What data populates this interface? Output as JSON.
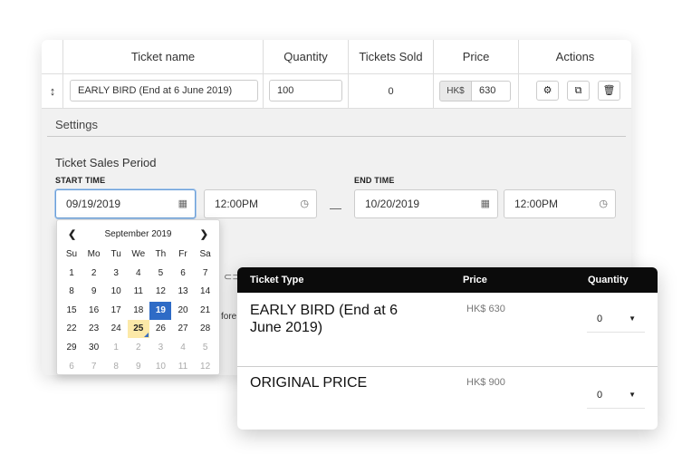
{
  "table": {
    "headers": [
      "Ticket name",
      "Quantity",
      "Tickets Sold",
      "Price",
      "Actions"
    ],
    "row": {
      "drag_icon": "drag-handle-icon",
      "ticket_name": "EARLY BIRD (End at 6 June 2019)",
      "quantity": "100",
      "tickets_sold": "0",
      "currency": "HK$",
      "price": "630",
      "actions": [
        "gear-icon",
        "copy-icon",
        "trash-icon"
      ]
    }
  },
  "settings": {
    "title": "Settings",
    "period_title": "Ticket Sales Period",
    "start_label": "START TIME",
    "end_label": "END TIME",
    "start_date": "09/19/2019",
    "start_time": "12:00PM",
    "end_date": "10/20/2019",
    "end_time": "12:00PM",
    "separator": "—",
    "partial_text": "fore"
  },
  "datepicker": {
    "month_label": "September 2019",
    "weekdays": [
      "Su",
      "Mo",
      "Tu",
      "We",
      "Th",
      "Fr",
      "Sa"
    ],
    "weeks": [
      [
        "1",
        "2",
        "3",
        "4",
        "5",
        "6",
        "7"
      ],
      [
        "8",
        "9",
        "10",
        "11",
        "12",
        "13",
        "14"
      ],
      [
        "15",
        "16",
        "17",
        "18",
        "19",
        "20",
        "21"
      ],
      [
        "22",
        "23",
        "24",
        "25",
        "26",
        "27",
        "28"
      ],
      [
        "29",
        "30",
        "1",
        "2",
        "3",
        "4",
        "5"
      ],
      [
        "6",
        "7",
        "8",
        "9",
        "10",
        "11",
        "12"
      ]
    ],
    "selected": "19",
    "today": "25"
  },
  "ticket_list": {
    "headers": {
      "type": "Ticket Type",
      "price": "Price",
      "quantity": "Quantity"
    },
    "items": [
      {
        "name": "EARLY BIRD (End at 6 June 2019)",
        "price": "HK$ 630",
        "quantity": "0"
      },
      {
        "name": "ORIGINAL PRICE",
        "price": "HK$ 900",
        "quantity": "0"
      }
    ]
  },
  "colors": {
    "selected_day": "#2e6bc6",
    "today_highlight": "#fce9a8",
    "header_dark": "#0b0b0b"
  }
}
